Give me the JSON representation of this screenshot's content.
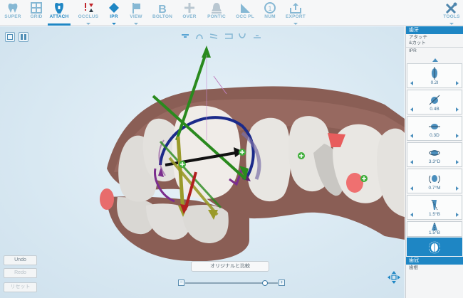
{
  "toolbar": {
    "items": [
      {
        "label": "SUPER",
        "icon": "tooth-outline-icon",
        "active": false,
        "dropdown": false
      },
      {
        "label": "GRID",
        "icon": "grid-icon",
        "active": false,
        "dropdown": false
      },
      {
        "label": "ATTACH",
        "icon": "attachment-tooth-icon",
        "active": true,
        "dropdown": false
      },
      {
        "label": "OCCLUS",
        "icon": "occlusion-icon",
        "active": false,
        "dropdown": true
      },
      {
        "label": "IPR",
        "icon": "ipr-diamond-icon",
        "active": false,
        "dropdown": true
      },
      {
        "label": "VIEW",
        "icon": "view-flag-icon",
        "active": false,
        "dropdown": true
      },
      {
        "label": "BOLTON",
        "icon": "bolton-b-icon",
        "active": false,
        "dropdown": false
      },
      {
        "label": "OVER",
        "icon": "overlay-cross-icon",
        "active": false,
        "dropdown": false
      },
      {
        "label": "PONTIC",
        "icon": "pontic-bell-icon",
        "active": false,
        "dropdown": false
      },
      {
        "label": "OCC PL",
        "icon": "occlusal-plane-icon",
        "active": false,
        "dropdown": false
      },
      {
        "label": "NUM",
        "icon": "numbering-icon",
        "active": false,
        "dropdown": false
      },
      {
        "label": "EXPORT",
        "icon": "export-icon",
        "active": false,
        "dropdown": true
      }
    ],
    "tools_label": "TOOLS"
  },
  "view_orientation_icons": [
    "jaw-upper-icon",
    "arch-icon",
    "both-jaws-icon",
    "jaw-lower-open-icon",
    "arch-down-icon",
    "jaw-lower-icon"
  ],
  "viewport": {
    "compare_button": "オリジナルと比較",
    "undo_label": "Undo",
    "redo_label": "Redo",
    "reset_label": "リセット",
    "slider_minus": "−",
    "slider_plus": "+",
    "slider_position": 0.86
  },
  "panel": {
    "header_top": "歯牙",
    "attach_line1": "アタッチ",
    "attach_line2": "&カット",
    "ipr_label": "IPR",
    "values": [
      "0.2I",
      "0.4B",
      "0.3D",
      "3.3°D",
      "0.7°M",
      "1.5°B",
      "1.5°B"
    ],
    "header_bottom": "歯冠",
    "bottom_label": "歯根"
  },
  "colors": {
    "accent": "#1e86c4",
    "gum": "#8a5e55",
    "tooth": "#e8e6e2",
    "attachment": "#e85d5d",
    "axis_green": "#2a8a1e",
    "axis_black": "#111111",
    "axis_olive": "#9a9a2a",
    "axis_red": "#b02020",
    "arc_navy": "#1b2a8a",
    "arc_purple": "#7b2d8e"
  }
}
